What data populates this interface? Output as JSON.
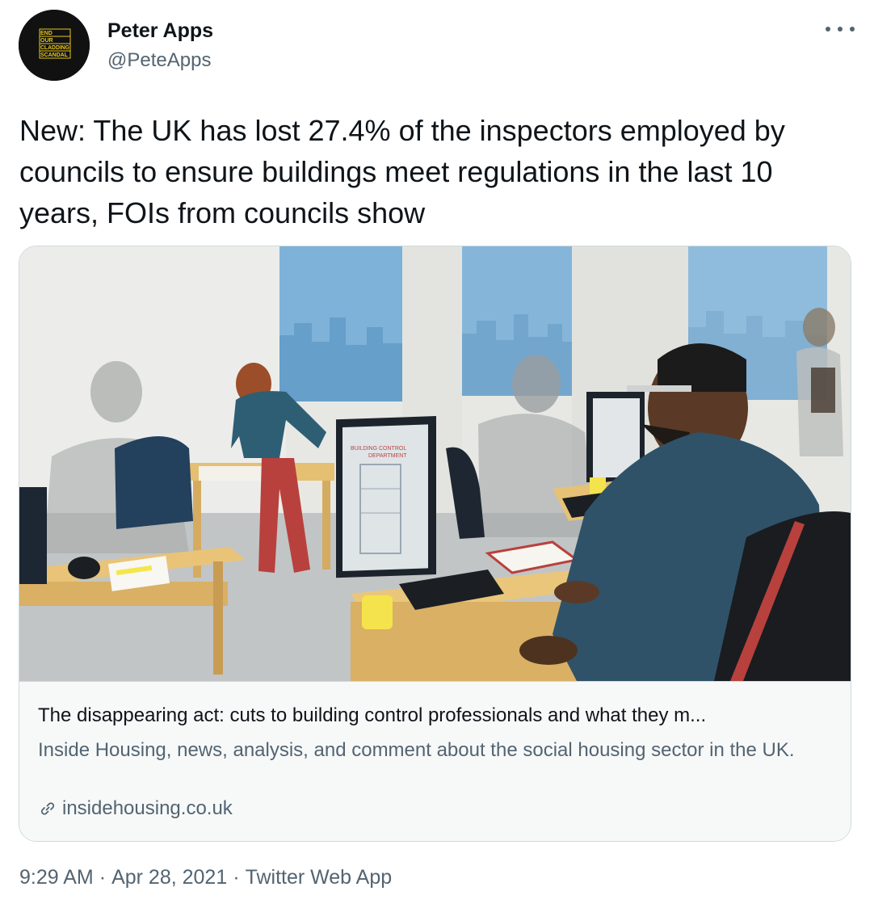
{
  "author": {
    "name": "Peter Apps",
    "handle": "@PeteApps",
    "avatar_text": [
      "END",
      "OUR",
      "CLADDING",
      "SCANDAL"
    ]
  },
  "tweet": {
    "text": "New: The UK has lost 27.4% of the inspectors employed by councils to ensure buildings meet regulations in the last 10 years, FOIs from councils show"
  },
  "card": {
    "image_text": [
      "BUILDING CONTROL",
      "DEPARTMENT"
    ],
    "title": "The disappearing act: cuts to building control professionals and what they m...",
    "description": "Inside Housing, news, analysis, and comment about the social housing sector in the UK.",
    "domain": "insidehousing.co.uk",
    "link_icon": "link-icon"
  },
  "meta": {
    "time": "9:29 AM",
    "separator": "·",
    "date": "Apr 28, 2021",
    "source": "Twitter Web App"
  },
  "colors": {
    "text_primary": "#0f1419",
    "text_secondary": "#536471",
    "border": "#cfd9de",
    "card_bg": "#f7f9f9",
    "avatar_yellow": "#e8c820"
  }
}
